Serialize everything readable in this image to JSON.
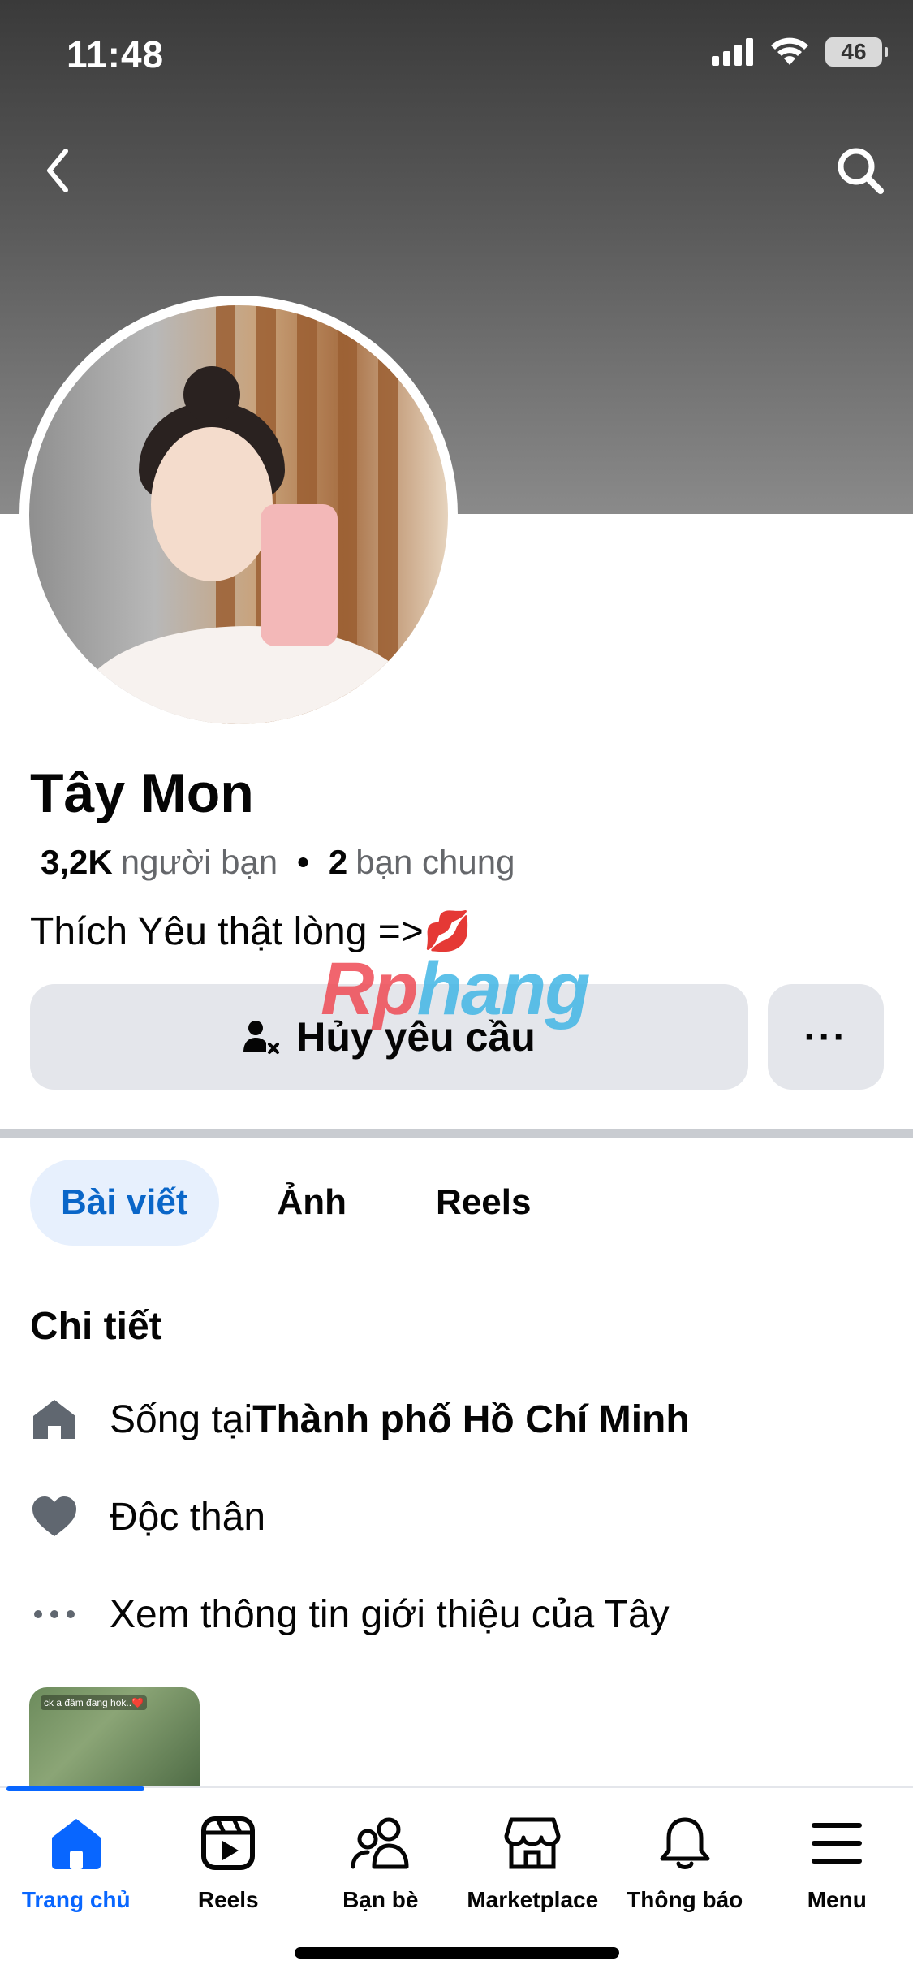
{
  "status_bar": {
    "time": "11:48",
    "battery": "46"
  },
  "profile": {
    "name": "Tây Mon",
    "friends_count": "3,2K",
    "friends_label": "người bạn",
    "separator": "•",
    "mutual_count": "2",
    "mutual_label": "bạn chung",
    "bio": "Thích Yêu thật lòng  =>💋"
  },
  "actions": {
    "cancel_request": "Hủy yêu cầu",
    "more": "···"
  },
  "watermark": {
    "part1": "Rp",
    "part2": "hang"
  },
  "tabs": [
    {
      "label": "Bài viết",
      "active": true
    },
    {
      "label": "Ảnh",
      "active": false
    },
    {
      "label": "Reels",
      "active": false
    }
  ],
  "details": {
    "title": "Chi tiết",
    "lives_prefix": "Sống tại ",
    "lives_city": "Thành phố Hồ Chí Minh",
    "relationship": "Độc thân",
    "see_about": "Xem thông tin giới thiệu của Tây"
  },
  "thumbnail_caption": "ck a đâm đang hok..❤️",
  "bottom_nav": [
    {
      "label": "Trang chủ",
      "icon": "home-icon",
      "active": true
    },
    {
      "label": "Reels",
      "icon": "reels-icon",
      "active": false
    },
    {
      "label": "Bạn bè",
      "icon": "friends-icon",
      "active": false
    },
    {
      "label": "Marketplace",
      "icon": "marketplace-icon",
      "active": false
    },
    {
      "label": "Thông báo",
      "icon": "bell-icon",
      "active": false
    },
    {
      "label": "Menu",
      "icon": "menu-icon",
      "active": false
    }
  ],
  "colors": {
    "accent": "#0866ff",
    "tab_active_bg": "#e7f0fd",
    "button_bg": "#e4e6eb"
  }
}
